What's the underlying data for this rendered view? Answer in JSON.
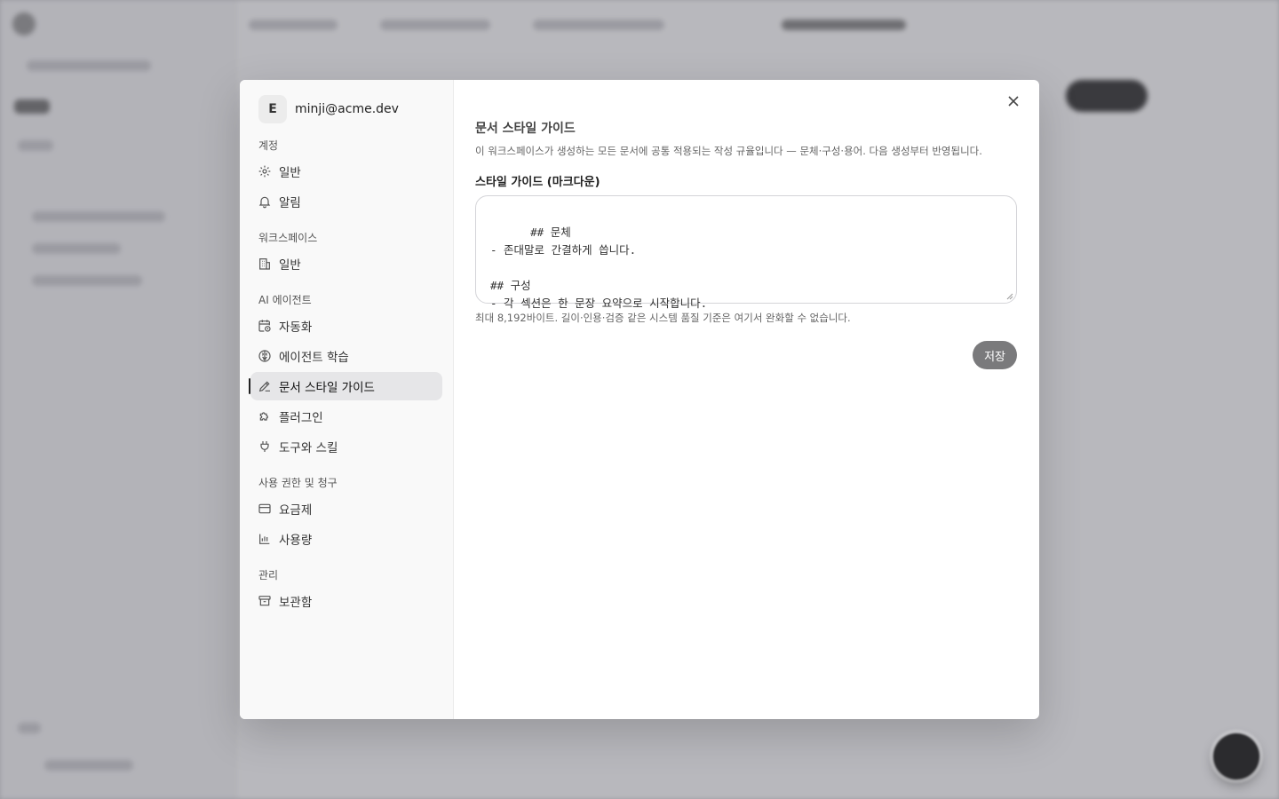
{
  "account": {
    "avatar_initial": "E",
    "email": "minji@acme.dev"
  },
  "nav": {
    "sections": [
      {
        "label": "계정",
        "items": [
          {
            "label": "일반",
            "icon": "gear-icon"
          },
          {
            "label": "알림",
            "icon": "bell-icon"
          }
        ]
      },
      {
        "label": "워크스페이스",
        "items": [
          {
            "label": "일반",
            "icon": "building-icon"
          }
        ]
      },
      {
        "label": "AI 에이전트",
        "items": [
          {
            "label": "자동화",
            "icon": "calendar-clock-icon"
          },
          {
            "label": "에이전트 학습",
            "icon": "brain-icon"
          },
          {
            "label": "문서 스타일 가이드",
            "icon": "pen-icon",
            "active": true
          },
          {
            "label": "플러그인",
            "icon": "puzzle-icon"
          },
          {
            "label": "도구와 스킬",
            "icon": "plug-icon"
          }
        ]
      },
      {
        "label": "사용 권한 및 청구",
        "items": [
          {
            "label": "요금제",
            "icon": "credit-card-icon"
          },
          {
            "label": "사용량",
            "icon": "bar-chart-icon"
          }
        ]
      },
      {
        "label": "관리",
        "items": [
          {
            "label": "보관함",
            "icon": "archive-icon"
          }
        ]
      }
    ]
  },
  "content": {
    "title": "문서 스타일 가이드",
    "description": "이 워크스페이스가 생성하는 모든 문서에 공통 적용되는 작성 규율입니다 — 문체·구성·용어. 다음 생성부터 반영됩니다.",
    "field_label": "스타일 가이드 (마크다운)",
    "editor_value": "## 문체\n- 존대말로 간결하게 씁니다.\n\n## 구성\n- 각 섹션은 한 문장 요약으로 시작합니다.",
    "hint": "최대 8,192바이트. 길이·인용·검증 같은 시스템 품질 기준은 여기서 완화할 수 없습니다.",
    "save_label": "저장"
  },
  "colors": {
    "save_button": "#7a7a7c",
    "active_nav": "#e6e6e8"
  }
}
